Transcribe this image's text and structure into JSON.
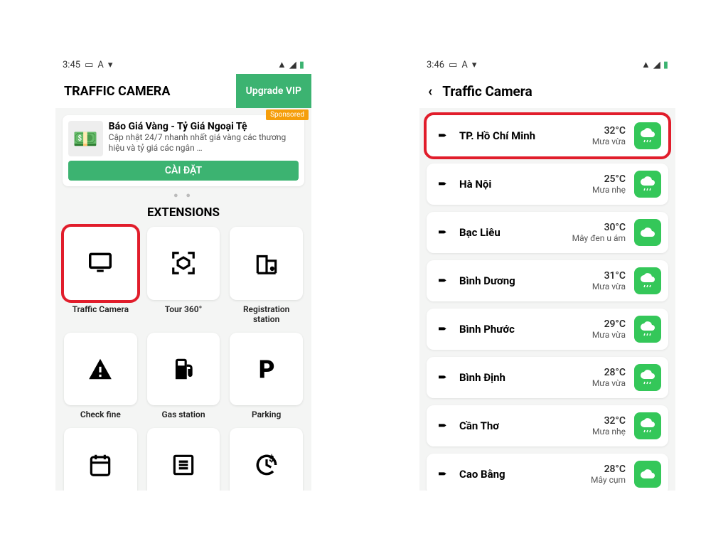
{
  "left": {
    "status_time": "3:45",
    "app_title": "TRAFFIC CAMERA",
    "upgrade_label": "Upgrade VIP",
    "ad": {
      "sponsored": "Sponsored",
      "title": "Báo Giá Vàng - Tỷ Giá Ngoại Tệ",
      "desc": "Cập nhật 24/7 nhanh nhất giá vàng các thương hiệu và tỷ giá các ngân …",
      "install": "CÀI ĐẶT",
      "image_emoji": "💵"
    },
    "section": "EXTENSIONS",
    "extensions": [
      {
        "icon": "monitor",
        "label": "Traffic Camera",
        "highlight": true
      },
      {
        "icon": "scan",
        "label": "Tour 360°",
        "highlight": false
      },
      {
        "icon": "building",
        "label": "Registration station",
        "highlight": false
      },
      {
        "icon": "warning",
        "label": "Check fine",
        "highlight": false
      },
      {
        "icon": "fuel",
        "label": "Gas station",
        "highlight": false
      },
      {
        "icon": "parking",
        "label": "Parking",
        "highlight": false
      },
      {
        "icon": "calendar",
        "label": "",
        "highlight": false
      },
      {
        "icon": "list",
        "label": "",
        "highlight": false
      },
      {
        "icon": "refresh",
        "label": "",
        "highlight": false
      }
    ]
  },
  "right": {
    "status_time": "3:46",
    "header": "Traffic Camera",
    "cities": [
      {
        "name": "TP. Hồ Chí Minh",
        "temp": "32°C",
        "cond": "Mưa vừa",
        "icon": "rain",
        "highlight": true
      },
      {
        "name": "Hà Nội",
        "temp": "25°C",
        "cond": "Mưa nhẹ",
        "icon": "rain",
        "highlight": false
      },
      {
        "name": "Bạc Liêu",
        "temp": "30°C",
        "cond": "Mây đen u ám",
        "icon": "cloud",
        "highlight": false
      },
      {
        "name": "Bình Dương",
        "temp": "31°C",
        "cond": "Mưa vừa",
        "icon": "rain",
        "highlight": false
      },
      {
        "name": "Bình Phước",
        "temp": "29°C",
        "cond": "Mưa vừa",
        "icon": "rain",
        "highlight": false
      },
      {
        "name": "Bình Định",
        "temp": "28°C",
        "cond": "Mưa vừa",
        "icon": "rain",
        "highlight": false
      },
      {
        "name": "Cần Thơ",
        "temp": "32°C",
        "cond": "Mưa nhẹ",
        "icon": "rain",
        "highlight": false
      },
      {
        "name": "Cao Bằng",
        "temp": "28°C",
        "cond": "Mây cụm",
        "icon": "cloud",
        "highlight": false
      }
    ]
  }
}
